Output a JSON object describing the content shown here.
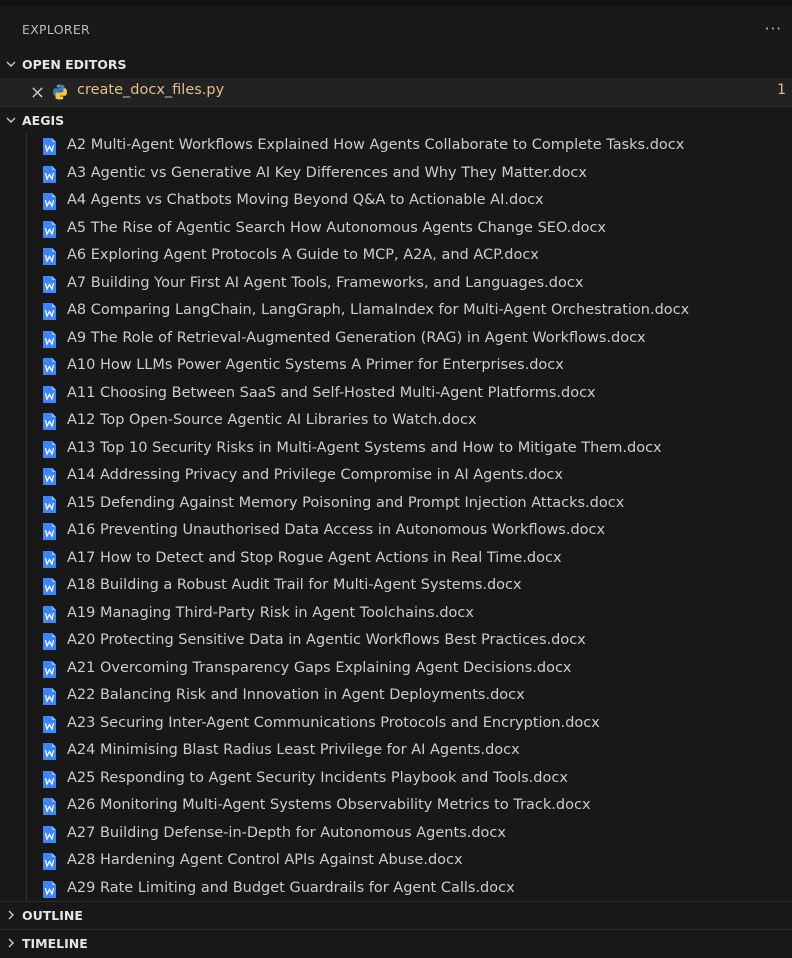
{
  "explorer": {
    "title": "EXPLORER",
    "more_label": "···"
  },
  "open_editors": {
    "title": "OPEN EDITORS",
    "file": "create_docx_files.py",
    "problems": "1"
  },
  "workspace": {
    "title": "AEGIS",
    "files": [
      "A2 Multi-Agent Workflows Explained How Agents Collaborate to Complete Tasks.docx",
      "A3 Agentic vs Generative AI Key Differences and Why They Matter.docx",
      "A4 Agents vs Chatbots Moving Beyond Q&A to Actionable AI.docx",
      "A5 The Rise of Agentic Search How Autonomous Agents Change SEO.docx",
      "A6 Exploring Agent Protocols A Guide to MCP, A2A, and ACP.docx",
      "A7 Building Your First AI Agent Tools, Frameworks, and Languages.docx",
      "A8 Comparing LangChain, LangGraph, LlamaIndex for Multi-Agent Orchestration.docx",
      "A9 The Role of Retrieval-Augmented Generation (RAG) in Agent Workflows.docx",
      "A10 How LLMs Power Agentic Systems A Primer for Enterprises.docx",
      "A11 Choosing Between SaaS and Self-Hosted Multi-Agent Platforms.docx",
      "A12 Top Open-Source Agentic AI Libraries to Watch.docx",
      "A13 Top 10 Security Risks in Multi-Agent Systems and How to Mitigate Them.docx",
      "A14 Addressing Privacy and Privilege Compromise in AI Agents.docx",
      "A15 Defending Against Memory Poisoning and Prompt Injection Attacks.docx",
      "A16 Preventing Unauthorised Data Access in Autonomous Workflows.docx",
      "A17 How to Detect and Stop Rogue Agent Actions in Real Time.docx",
      "A18 Building a Robust Audit Trail for Multi-Agent Systems.docx",
      "A19 Managing Third-Party Risk in Agent Toolchains.docx",
      "A20 Protecting Sensitive Data in Agentic Workflows Best Practices.docx",
      "A21 Overcoming Transparency Gaps Explaining Agent Decisions.docx",
      "A22 Balancing Risk and Innovation in Agent Deployments.docx",
      "A23 Securing Inter-Agent Communications Protocols and Encryption.docx",
      "A24 Minimising Blast Radius Least Privilege for AI Agents.docx",
      "A25 Responding to Agent Security Incidents Playbook and Tools.docx",
      "A26 Monitoring Multi-Agent Systems Observability Metrics to Track.docx",
      "A27 Building Defense-in-Depth for Autonomous Agents.docx",
      "A28 Hardening Agent Control APIs Against Abuse.docx",
      "A29 Rate Limiting and Budget Guardrails for Agent Calls.docx"
    ]
  },
  "outline": {
    "title": "OUTLINE"
  },
  "timeline": {
    "title": "TIMELINE"
  },
  "colors": {
    "background": "#181818",
    "modified_file": "#e2c08d",
    "docx_icon": "#3a86ff"
  },
  "icons": {
    "close": "close-icon",
    "python": "python-icon",
    "docx": "word-document-icon",
    "more": "ellipsis-icon"
  }
}
